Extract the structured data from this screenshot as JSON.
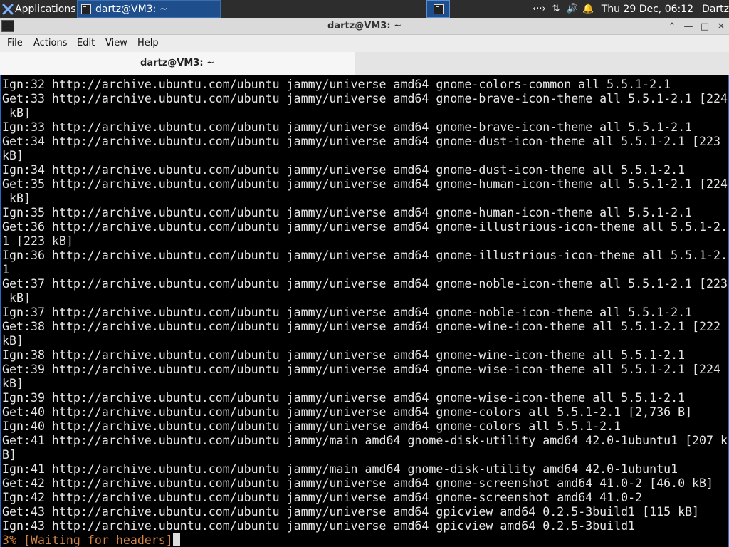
{
  "taskbar": {
    "applications_label": "Applications",
    "task_label": "dartz@VM3: ~",
    "clock": "Thu 29 Dec, 06:12",
    "user": "Dartz",
    "icons": [
      "network-icon",
      "transfer-icon",
      "volume-icon",
      "notification-bell-icon"
    ]
  },
  "window": {
    "title": "dartz@VM3: ~",
    "buttons": [
      "maximize-up-icon",
      "minimize-icon",
      "restore-icon",
      "close-icon"
    ]
  },
  "menu": [
    "File",
    "Actions",
    "Edit",
    "View",
    "Help"
  ],
  "tab": {
    "label": "dartz@VM3: ~"
  },
  "terminal": {
    "lines": [
      "Ign:32 http://archive.ubuntu.com/ubuntu jammy/universe amd64 gnome-colors-common all 5.5.1-2.1",
      "Get:33 http://archive.ubuntu.com/ubuntu jammy/universe amd64 gnome-brave-icon-theme all 5.5.1-2.1 [224",
      " kB]",
      "Ign:33 http://archive.ubuntu.com/ubuntu jammy/universe amd64 gnome-brave-icon-theme all 5.5.1-2.1",
      "Get:34 http://archive.ubuntu.com/ubuntu jammy/universe amd64 gnome-dust-icon-theme all 5.5.1-2.1 [223",
      "kB]",
      "Ign:34 http://archive.ubuntu.com/ubuntu jammy/universe amd64 gnome-dust-icon-theme all 5.5.1-2.1",
      "__LINK__",
      " kB]",
      "Ign:35 http://archive.ubuntu.com/ubuntu jammy/universe amd64 gnome-human-icon-theme all 5.5.1-2.1",
      "Get:36 http://archive.ubuntu.com/ubuntu jammy/universe amd64 gnome-illustrious-icon-theme all 5.5.1-2.",
      "1 [223 kB]",
      "Ign:36 http://archive.ubuntu.com/ubuntu jammy/universe amd64 gnome-illustrious-icon-theme all 5.5.1-2.",
      "1",
      "Get:37 http://archive.ubuntu.com/ubuntu jammy/universe amd64 gnome-noble-icon-theme all 5.5.1-2.1 [223",
      " kB]",
      "Ign:37 http://archive.ubuntu.com/ubuntu jammy/universe amd64 gnome-noble-icon-theme all 5.5.1-2.1",
      "Get:38 http://archive.ubuntu.com/ubuntu jammy/universe amd64 gnome-wine-icon-theme all 5.5.1-2.1 [222",
      "kB]",
      "Ign:38 http://archive.ubuntu.com/ubuntu jammy/universe amd64 gnome-wine-icon-theme all 5.5.1-2.1",
      "Get:39 http://archive.ubuntu.com/ubuntu jammy/universe amd64 gnome-wise-icon-theme all 5.5.1-2.1 [224",
      "kB]",
      "Ign:39 http://archive.ubuntu.com/ubuntu jammy/universe amd64 gnome-wise-icon-theme all 5.5.1-2.1",
      "Get:40 http://archive.ubuntu.com/ubuntu jammy/universe amd64 gnome-colors all 5.5.1-2.1 [2,736 B]",
      "Ign:40 http://archive.ubuntu.com/ubuntu jammy/universe amd64 gnome-colors all 5.5.1-2.1",
      "Get:41 http://archive.ubuntu.com/ubuntu jammy/main amd64 gnome-disk-utility amd64 42.0-1ubuntu1 [207 k",
      "B]",
      "Ign:41 http://archive.ubuntu.com/ubuntu jammy/main amd64 gnome-disk-utility amd64 42.0-1ubuntu1",
      "Get:42 http://archive.ubuntu.com/ubuntu jammy/universe amd64 gnome-screenshot amd64 41.0-2 [46.0 kB]",
      "Ign:42 http://archive.ubuntu.com/ubuntu jammy/universe amd64 gnome-screenshot amd64 41.0-2",
      "Get:43 http://archive.ubuntu.com/ubuntu jammy/universe amd64 gpicview amd64 0.2.5-3build1 [115 kB]",
      "Ign:43 http://archive.ubuntu.com/ubuntu jammy/universe amd64 gpicview amd64 0.2.5-3build1"
    ],
    "link_line": {
      "prefix": "Get:35 ",
      "link": "http://archive.ubuntu.com/ubuntu",
      "suffix": " jammy/universe amd64 gnome-human-icon-theme all 5.5.1-2.1 [224"
    },
    "progress_line": "3% [Waiting for headers]",
    "colors": {
      "background": "#000000",
      "text": "#e6e6e6",
      "progress": "#d28445"
    }
  }
}
